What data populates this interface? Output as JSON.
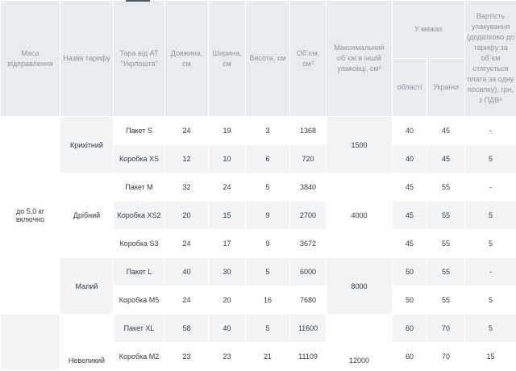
{
  "headers": {
    "mass": "Маса відправлення",
    "tariff_name": "Назва тарифу",
    "package": "Тара від АТ \"Укрпошта\"",
    "length": "Довжина, см",
    "width": "Ширина, см",
    "height": "Висота, см",
    "volume": "Об`єм, см³",
    "max_volume": "Максимальний об`єм в іншій упаковці, см³",
    "within": "У межах",
    "region": "області",
    "ukraine": "України",
    "packaging_cost": "Вартість упакування (додатково до тарифу за об`єм стягується плата за одну посилку), грн, з ПДВ⁸"
  },
  "mass_groups": [
    "до 5,0 кг включно",
    ""
  ],
  "tariffs": [
    {
      "name": "Крихітний",
      "max_volume": "1500"
    },
    {
      "name": "Дрібний",
      "max_volume": "4000"
    },
    {
      "name": "Малий",
      "max_volume": "8000"
    },
    {
      "name": "Невеликий",
      "max_volume": "12000"
    }
  ],
  "rows": [
    {
      "package": "Пакет S",
      "length": "24",
      "width": "19",
      "height": "3",
      "volume": "1368",
      "region": "40",
      "ukraine": "45",
      "cost": "-"
    },
    {
      "package": "Коробка XS",
      "length": "12",
      "width": "10",
      "height": "6",
      "volume": "720",
      "region": "40",
      "ukraine": "45",
      "cost": "5"
    },
    {
      "package": "Пакет M",
      "length": "32",
      "width": "24",
      "height": "5",
      "volume": "3840",
      "region": "45",
      "ukraine": "55",
      "cost": "-"
    },
    {
      "package": "Коробка XS2",
      "length": "20",
      "width": "15",
      "height": "9",
      "volume": "2700",
      "region": "45",
      "ukraine": "55",
      "cost": "5"
    },
    {
      "package": "Коробка S3",
      "length": "24",
      "width": "17",
      "height": "9",
      "volume": "3672",
      "region": "45",
      "ukraine": "55",
      "cost": "5"
    },
    {
      "package": "Пакет L",
      "length": "40",
      "width": "30",
      "height": "5",
      "volume": "6000",
      "region": "50",
      "ukraine": "55",
      "cost": "-"
    },
    {
      "package": "Коробка M5",
      "length": "24",
      "width": "20",
      "height": "16",
      "volume": "7680",
      "region": "50",
      "ukraine": "55",
      "cost": "5"
    },
    {
      "package": "Пакет XL",
      "length": "58",
      "width": "40",
      "height": "5",
      "volume": "11600",
      "region": "60",
      "ukraine": "70",
      "cost": "5"
    },
    {
      "package": "Коробка M2",
      "length": "23",
      "width": "23",
      "height": "21",
      "volume": "11109",
      "region": "60",
      "ukraine": "70",
      "cost": "15"
    }
  ]
}
